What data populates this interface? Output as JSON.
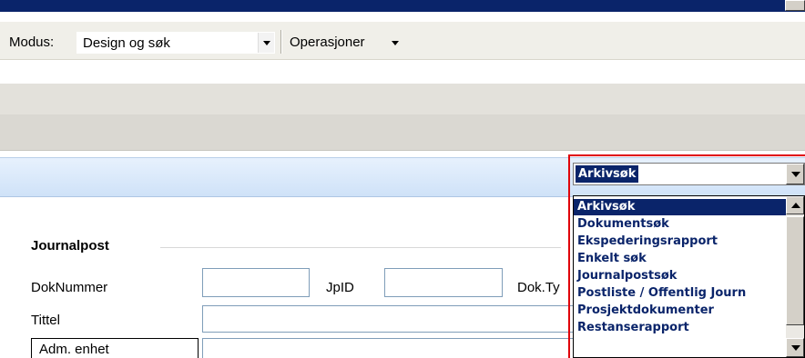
{
  "toolbar": {
    "modus_label": "Modus:",
    "modus_value": "Design og søk",
    "operations_label": "Operasjoner"
  },
  "form": {
    "section_title": "Journalpost",
    "fields": {
      "doknummer_label": "DokNummer",
      "jpid_label": "JpID",
      "doktype_label": "Dok.Ty",
      "tittel_label": "Tittel",
      "adm_enhet_label": "Adm. enhet"
    }
  },
  "search_select": {
    "selected": "Arkivsøk",
    "options": [
      "Arkivsøk",
      "Dokumentsøk",
      "Ekspederingsrapport",
      "Enkelt søk",
      "Journalpostsøk",
      "Postliste / Offentlig Journ",
      "Prosjektdokumenter",
      "Restanserapport"
    ]
  },
  "colors": {
    "title_bar": "#0a246a",
    "highlight": "#0a246a",
    "item_text": "#0a246a",
    "annotation": "#e0000a",
    "header_band": "#dbe9fa"
  }
}
